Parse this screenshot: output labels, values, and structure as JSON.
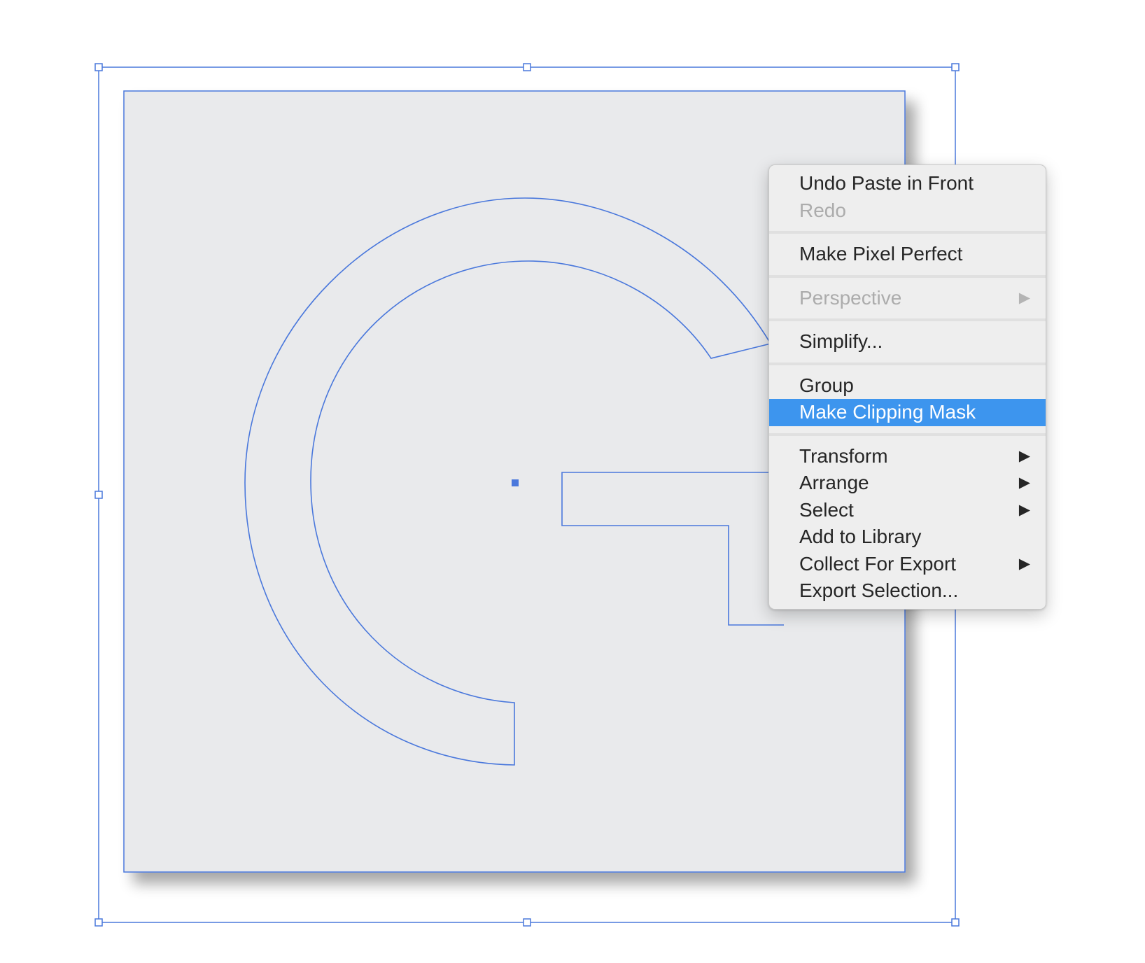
{
  "canvas": {
    "selection_color": "#4a78dc",
    "artboard_fill": "#e9eaec",
    "background": "#ffffff"
  },
  "context_menu": {
    "highlight_color": "#3d95ee",
    "groups": [
      [
        {
          "label": "Undo Paste in Front",
          "enabled": true
        },
        {
          "label": "Redo",
          "enabled": false
        }
      ],
      [
        {
          "label": "Make Pixel Perfect",
          "enabled": true
        }
      ],
      [
        {
          "label": "Perspective",
          "enabled": false,
          "submenu": true
        }
      ],
      [
        {
          "label": "Simplify...",
          "enabled": true
        }
      ],
      [
        {
          "label": "Group",
          "enabled": true
        },
        {
          "label": "Make Clipping Mask",
          "enabled": true,
          "highlighted": true
        }
      ],
      [
        {
          "label": "Transform",
          "enabled": true,
          "submenu": true
        },
        {
          "label": "Arrange",
          "enabled": true,
          "submenu": true
        },
        {
          "label": "Select",
          "enabled": true,
          "submenu": true
        },
        {
          "label": "Add to Library",
          "enabled": true
        },
        {
          "label": "Collect For Export",
          "enabled": true,
          "submenu": true
        },
        {
          "label": "Export Selection...",
          "enabled": true
        }
      ]
    ],
    "submenu_arrow": "▶"
  }
}
